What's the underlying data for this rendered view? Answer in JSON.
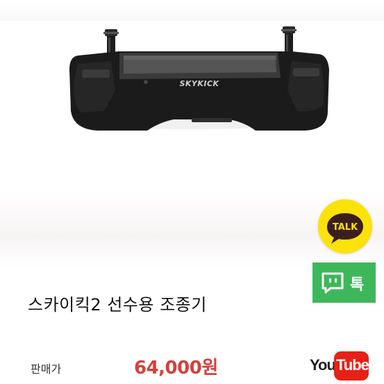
{
  "product": {
    "image_alt": "SKYKICK",
    "brand_text": "SKYKICK",
    "title": "스카이킥2 선수용 조종기",
    "price_label": "판매가",
    "price_value": "64,000원"
  },
  "floating": {
    "talk_label": "TALK",
    "tok_label": "톡"
  },
  "youtube": {
    "you": "You",
    "tube": "Tube"
  },
  "colors": {
    "price": "#d6403a",
    "kakao_yellow": "#fbe20a",
    "tok_green": "#3eb75b",
    "youtube_red": "#e62117"
  }
}
